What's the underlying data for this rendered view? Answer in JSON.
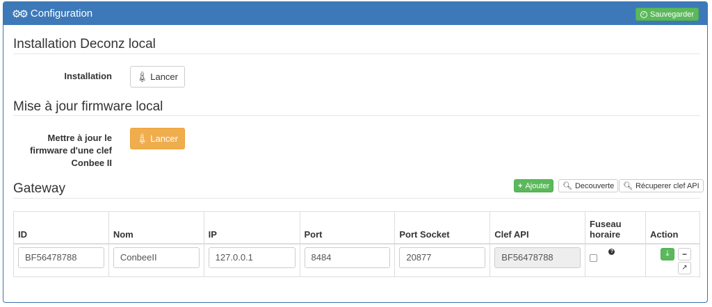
{
  "header": {
    "title": "Configuration",
    "save_label": "Sauvegarder",
    "bg_color": "#3d79b8"
  },
  "install_section": {
    "title": "Installation Deconz local",
    "label": "Installation",
    "button_label": "Lancer"
  },
  "firmware_section": {
    "title": "Mise à jour firmware local",
    "label_line1": "Mettre à jour le",
    "label_line2": "firmware d'une clef",
    "label_line3": "Conbee II",
    "button_label": "Lancer",
    "button_color": "#f0ad4e"
  },
  "gateway_section": {
    "title": "Gateway",
    "add_label": "Ajouter",
    "discover_label": "Decouverte",
    "fetch_key_label": "Récuperer clef API",
    "columns": [
      "ID",
      "Nom",
      "IP",
      "Port",
      "Port Socket",
      "Clef API",
      "Fuseau horaire",
      "Action"
    ],
    "timezone_header_line1": "Fuseau",
    "timezone_header_line2": "horaire",
    "rows": [
      {
        "id": "BF56478788",
        "nom": "ConbeeII",
        "ip": "127.0.0.1",
        "port": "8484",
        "port_socket": "20877",
        "api_key": "BF56478788",
        "timezone_checked": false
      }
    ]
  },
  "icons": {
    "header": "gears-icon",
    "save": "check-circle-icon",
    "launch": "rocket-icon",
    "add": "plus-icon",
    "search": "search-icon",
    "help": "question-circle-icon",
    "download": "download-icon",
    "remove": "minus-icon",
    "external": "external-link-icon"
  }
}
